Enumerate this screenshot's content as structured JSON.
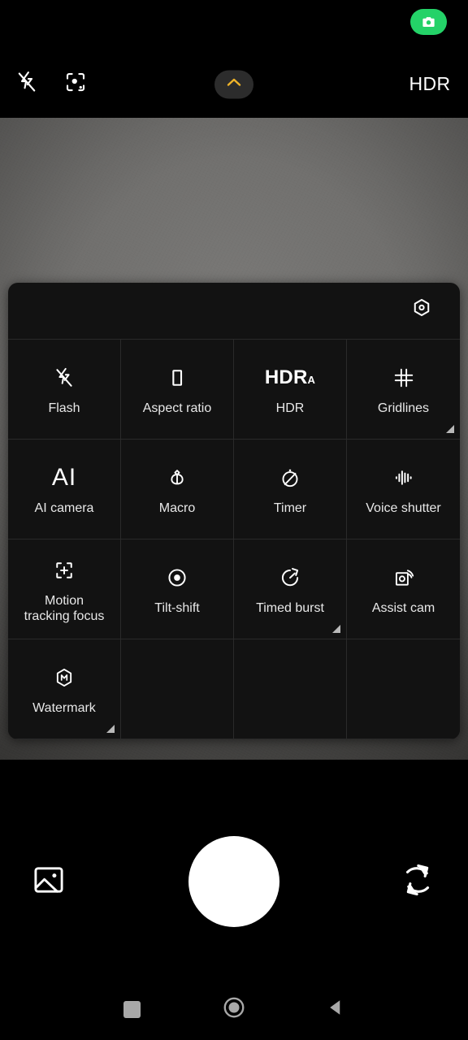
{
  "app": {
    "name": "Camera",
    "accent_amber": "#f0b429",
    "badge_green": "#24d268",
    "panel_bg": "#121212",
    "divider": "#2a2a2a"
  },
  "status_bar": {
    "badge_icon": "camera-icon"
  },
  "top_bar": {
    "flash": {
      "label": "Flash off",
      "icon": "flash-off-icon"
    },
    "scene_detect": {
      "label": "AI scene detection",
      "icon": "focus-scan-icon"
    },
    "expand": {
      "label": "Expand settings",
      "icon": "chevron-up-icon"
    },
    "hdr": {
      "label": "HDR",
      "icon": "hdr-text"
    }
  },
  "settings_panel": {
    "header": {
      "more_settings": {
        "label": "More settings",
        "icon": "hexagon-settings-icon"
      }
    },
    "tiles": [
      {
        "label": "Flash",
        "icon": "flash-off-icon",
        "corner": false
      },
      {
        "label": "Aspect ratio",
        "icon": "rectangle-icon",
        "corner": false
      },
      {
        "label": "HDR",
        "icon": "hdr-auto-icon",
        "corner": false,
        "icon_text": "HDR",
        "icon_sub": "A"
      },
      {
        "label": "Gridlines",
        "icon": "gridlines-icon",
        "corner": true
      },
      {
        "label": "AI camera",
        "icon": "ai-text-icon",
        "corner": false,
        "icon_text": "AI"
      },
      {
        "label": "Macro",
        "icon": "flower-icon",
        "corner": false
      },
      {
        "label": "Timer",
        "icon": "timer-off-icon",
        "corner": false
      },
      {
        "label": "Voice shutter",
        "icon": "waveform-icon",
        "corner": false
      },
      {
        "label": "Motion\ntracking focus",
        "icon": "focus-plus-icon",
        "corner": false
      },
      {
        "label": "Tilt-shift",
        "icon": "concentric-circle-icon",
        "corner": false
      },
      {
        "label": "Timed burst",
        "icon": "stopwatch-arrow-icon",
        "corner": true
      },
      {
        "label": "Assist cam",
        "icon": "wireless-camera-icon",
        "corner": false
      },
      {
        "label": "Watermark",
        "icon": "hexagon-m-icon",
        "corner": true
      },
      {
        "label": "",
        "icon": "",
        "corner": false
      },
      {
        "label": "",
        "icon": "",
        "corner": false
      },
      {
        "label": "",
        "icon": "",
        "corner": false
      }
    ]
  },
  "action_bar": {
    "gallery": {
      "label": "Gallery",
      "icon": "image-icon"
    },
    "shutter": {
      "label": "Shutter",
      "icon": "shutter-circle-icon"
    },
    "flip": {
      "label": "Switch camera",
      "icon": "camera-flip-icon"
    }
  },
  "nav_bar": {
    "recents": {
      "label": "Recent apps",
      "icon": "square-icon"
    },
    "home": {
      "label": "Home",
      "icon": "circle-icon"
    },
    "back": {
      "label": "Back",
      "icon": "triangle-left-icon"
    }
  }
}
